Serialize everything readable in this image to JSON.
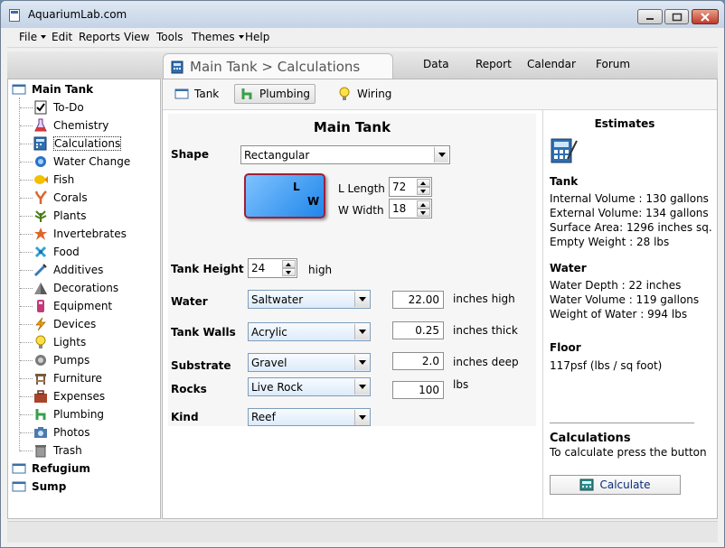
{
  "window": {
    "title": "AquariumLab.com"
  },
  "menu": [
    "File",
    "Edit",
    "Reports",
    "View",
    "Tools",
    "Themes",
    "Help"
  ],
  "nav": {
    "active_tab": "Main Tank > Calculations",
    "links": [
      "Data",
      "Report",
      "Calendar",
      "Forum"
    ]
  },
  "tree": {
    "root": "Main Tank",
    "items": [
      "To-Do",
      "Chemistry",
      "Calculations",
      "Water Change",
      "Fish",
      "Corals",
      "Plants",
      "Invertebrates",
      "Food",
      "Additives",
      "Decorations",
      "Equipment",
      "Devices",
      "Lights",
      "Pumps",
      "Furniture",
      "Expenses",
      "Plumbing",
      "Photos",
      "Trash"
    ],
    "selected": "Calculations",
    "other_roots": [
      "Refugium",
      "Sump"
    ]
  },
  "subtabs": [
    "Tank",
    "Plumbing",
    "Wiring"
  ],
  "form": {
    "title": "Main Tank",
    "shape_label": "Shape",
    "shape_value": "Rectangular",
    "preview_l": "L",
    "preview_w": "W",
    "length_label": "L Length",
    "length_value": "72",
    "width_label": "W Width",
    "width_value": "18",
    "height_label": "Tank Height",
    "height_value": "24",
    "height_unit": "high",
    "water_label": "Water",
    "water_value": "Saltwater",
    "water_num": "22.00",
    "water_unit": "inches high",
    "walls_label": "Tank Walls",
    "walls_value": "Acrylic",
    "walls_num": "0.25",
    "walls_unit": "inches thick",
    "substrate_label": "Substrate",
    "substrate_value": "Gravel",
    "substrate_num": "2.0",
    "substrate_unit": "inches deep",
    "rocks_label": "Rocks",
    "rocks_value": "Live Rock",
    "rocks_num": "100",
    "rocks_unit": "lbs",
    "kind_label": "Kind",
    "kind_value": "Reef"
  },
  "estimates": {
    "title": "Estimates",
    "tank_title": "Tank",
    "tank_lines": [
      "Internal Volume : 130 gallons",
      "External Volume: 134 gallons",
      "Surface Area: 1296 inches sq.",
      "Empty Weight : 28 lbs"
    ],
    "water_title": "Water",
    "water_lines": [
      "Water Depth : 22 inches",
      "Water Volume : 119 gallons",
      "Weight of Water : 994 lbs"
    ],
    "floor_title": "Floor",
    "floor_lines": [
      "117psf (lbs / sq foot)"
    ],
    "calc_title": "Calculations",
    "calc_hint": "To calculate press the button",
    "calc_button": "Calculate"
  }
}
